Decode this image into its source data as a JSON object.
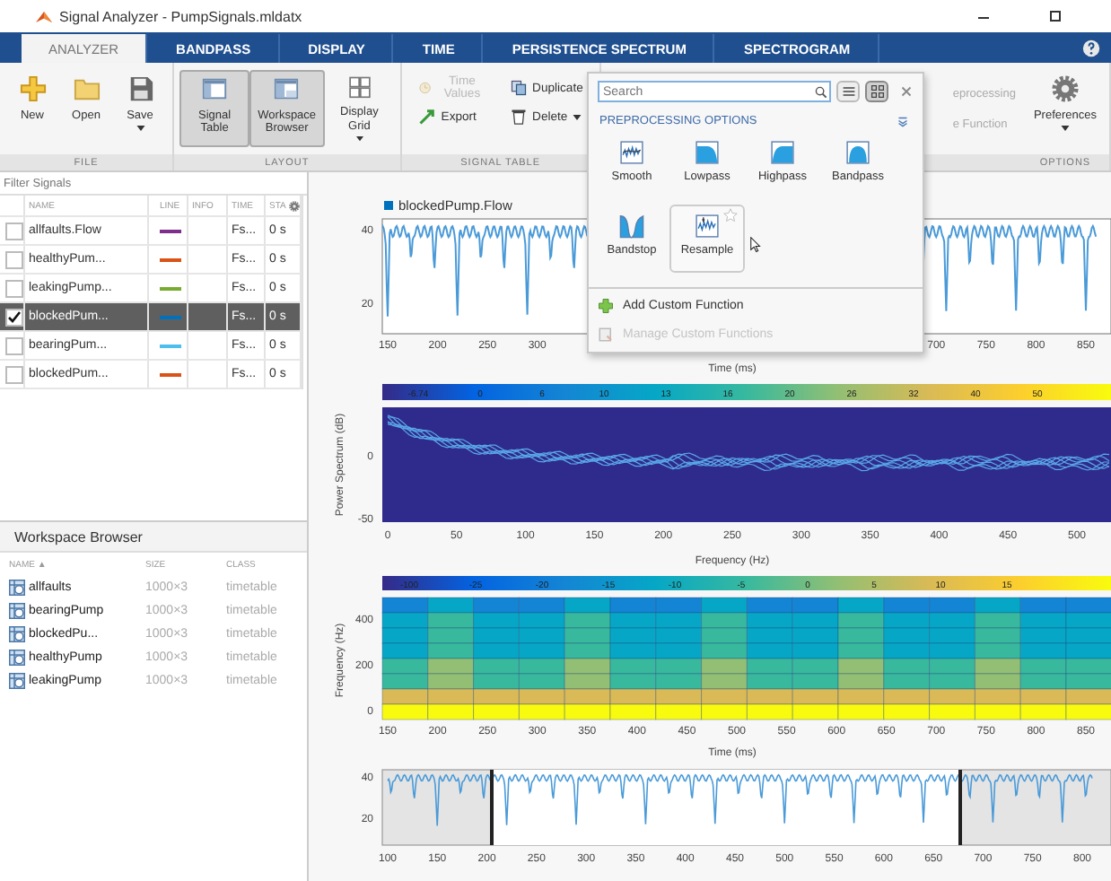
{
  "window": {
    "title": "Signal Analyzer - PumpSignals.mldatx"
  },
  "tabs": [
    {
      "label": "ANALYZER",
      "selected": true
    },
    {
      "label": "BANDPASS",
      "selected": false
    },
    {
      "label": "DISPLAY",
      "selected": false
    },
    {
      "label": "TIME",
      "selected": false
    },
    {
      "label": "PERSISTENCE SPECTRUM",
      "selected": false
    },
    {
      "label": "SPECTROGRAM",
      "selected": false
    }
  ],
  "toolstrip": {
    "sections": [
      {
        "kind": "large",
        "label": "FILE",
        "buttons": [
          {
            "label": "New",
            "on": false,
            "dropdown": false
          },
          {
            "label": "Open",
            "on": false,
            "dropdown": false
          },
          {
            "label": "Save",
            "on": false,
            "dropdown": true
          }
        ]
      },
      {
        "kind": "large",
        "label": "LAYOUT",
        "buttons": [
          {
            "label": "Signal Table",
            "on": true,
            "dropdown": false
          },
          {
            "label": "Workspace Browser",
            "on": true,
            "dropdown": false
          },
          {
            "label": "Display Grid",
            "on": false,
            "dropdown": true
          }
        ]
      },
      {
        "kind": "small",
        "label": "SIGNAL TABLE",
        "buttons": [
          {
            "label": "Time Values",
            "disabled": true,
            "dropdown": false
          },
          {
            "label": "Export",
            "disabled": false,
            "dropdown": false
          },
          {
            "label": "Duplicate",
            "disabled": false,
            "dropdown": false
          },
          {
            "label": "Delete",
            "disabled": false,
            "dropdown": true
          }
        ]
      },
      {
        "kind": "covered",
        "buttons": [
          {
            "label": "eprocessing"
          },
          {
            "label": "e Function"
          }
        ]
      },
      {
        "kind": "large",
        "label": "OPTIONS",
        "buttons": [
          {
            "label": "Preferences",
            "on": false,
            "dropdown": true
          }
        ]
      }
    ]
  },
  "signal_table": {
    "filter": {
      "placeholder": "Filter Signals"
    },
    "columns": [
      "NAME",
      "LINE",
      "INFO",
      "TIME",
      "STA"
    ],
    "rows": [
      {
        "name": "allfaults.Flow",
        "color": "#7e2f8e",
        "time": "Fs...",
        "start": "0 s",
        "checked": false,
        "selected": false
      },
      {
        "name": "healthyPum...",
        "color": "#d95319",
        "time": "Fs...",
        "start": "0 s",
        "checked": false,
        "selected": false
      },
      {
        "name": "leakingPump...",
        "color": "#77ac30",
        "time": "Fs...",
        "start": "0 s",
        "checked": false,
        "selected": false
      },
      {
        "name": "blockedPum...",
        "color": "#0072bd",
        "time": "Fs...",
        "start": "0 s",
        "checked": true,
        "selected": true
      },
      {
        "name": "bearingPum...",
        "color": "#4dbeee",
        "time": "Fs...",
        "start": "0 s",
        "checked": false,
        "selected": false
      },
      {
        "name": "blockedPum...",
        "color": "#d95319",
        "time": "Fs...",
        "start": "0 s",
        "checked": false,
        "selected": false
      }
    ]
  },
  "workspace_browser": {
    "title": "Workspace Browser",
    "columns": [
      "NAME ▲",
      "SIZE",
      "CLASS"
    ],
    "rows": [
      {
        "name": "allfaults",
        "size": "1000×3",
        "class": "timetable"
      },
      {
        "name": "bearingPump",
        "size": "1000×3",
        "class": "timetable"
      },
      {
        "name": "blockedPu...",
        "size": "1000×3",
        "class": "timetable"
      },
      {
        "name": "healthyPump",
        "size": "1000×3",
        "class": "timetable"
      },
      {
        "name": "leakingPump",
        "size": "1000×3",
        "class": "timetable"
      }
    ]
  },
  "display": {
    "legend": "blockedPump.Flow",
    "time_plot": {
      "yticks": [
        "40",
        "20"
      ],
      "xticks": [
        "150",
        "200",
        "250",
        "300",
        "700",
        "750",
        "800",
        "850"
      ],
      "xlabel": "Time (ms)"
    },
    "spectrum_colorbar": [
      "-6.74",
      "0",
      "6",
      "10",
      "13",
      "16",
      "20",
      "26",
      "32",
      "40",
      "50"
    ],
    "persistence_plot": {
      "ylabel": "Power Spectrum (dB)",
      "yticks": [
        "0",
        "-50"
      ],
      "xticks": [
        "0",
        "50",
        "100",
        "150",
        "200",
        "250",
        "300",
        "350",
        "400",
        "450",
        "500"
      ],
      "xlabel": "Frequency (Hz)"
    },
    "spectrogram_colorbar": [
      "-100",
      "-25",
      "-20",
      "-15",
      "-10",
      "-5",
      "0",
      "5",
      "10",
      "15"
    ],
    "spectrogram_plot": {
      "ylabel": "Frequency (Hz)",
      "yticks": [
        "400",
        "200",
        "0"
      ],
      "xticks": [
        "150",
        "200",
        "250",
        "300",
        "350",
        "400",
        "450",
        "500",
        "550",
        "600",
        "650",
        "700",
        "750",
        "800",
        "850"
      ],
      "xlabel": "Time (ms)"
    },
    "panner": {
      "yticks": [
        "40",
        "20"
      ],
      "xticks": [
        "100",
        "150",
        "200",
        "250",
        "300",
        "350",
        "400",
        "450",
        "500",
        "550",
        "600",
        "650",
        "700",
        "750",
        "800"
      ]
    }
  },
  "popup": {
    "search": {
      "placeholder": "Search"
    },
    "views": [
      {
        "kind": "list",
        "selected": false
      },
      {
        "kind": "grid",
        "selected": true
      }
    ],
    "title": "PREPROCESSING OPTIONS",
    "options": [
      {
        "label": "Smooth",
        "selected": false
      },
      {
        "label": "Lowpass",
        "selected": false
      },
      {
        "label": "Highpass",
        "selected": false
      },
      {
        "label": "Bandpass",
        "selected": false
      },
      {
        "label": "Bandstop",
        "selected": false
      },
      {
        "label": "Resample",
        "selected": true
      }
    ],
    "actions": [
      {
        "label": "Add Custom Function",
        "disabled": false
      },
      {
        "label": "Manage Custom Functions",
        "disabled": true
      }
    ]
  }
}
